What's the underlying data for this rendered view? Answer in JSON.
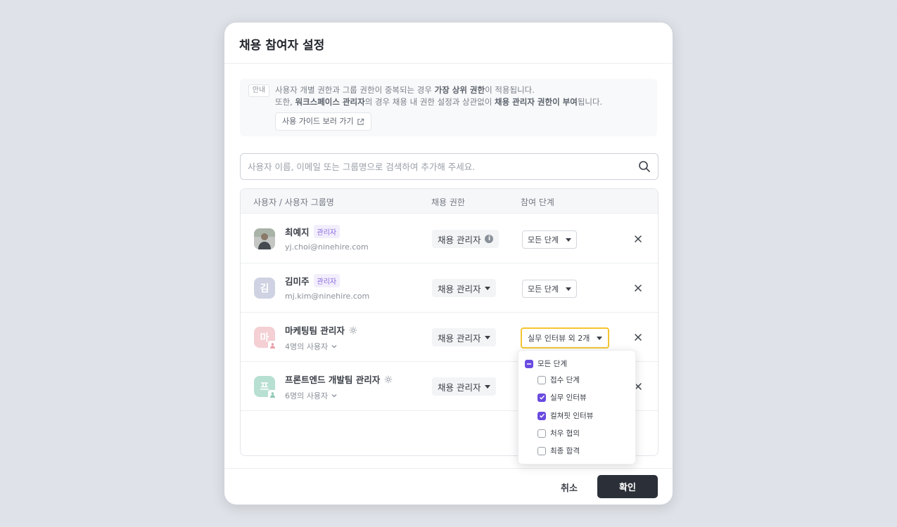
{
  "modal": {
    "title": "채용 참여자 설정"
  },
  "notice": {
    "tag": "안내",
    "line1_pre": "사용자 개별 권한과 그룹 권한이 중복되는 경우 ",
    "line1_bold": "가장 상위 권한",
    "line1_post": "이 적용됩니다.",
    "line2_pre": "또한, ",
    "line2_bold1": "워크스페이스 관리자",
    "line2_mid": "의 경우 채용 내 권한 설정과 상관없이 ",
    "line2_bold2": "채용 관리자 권한이 부여",
    "line2_post": "됩니다.",
    "guide_button": "사용 가이드 보러 가기"
  },
  "search": {
    "placeholder": "사용자 이름, 이메일 또는 그룹명으로 검색하여 추가해 주세요."
  },
  "table": {
    "headers": [
      "사용자 / 사용자 그룹명",
      "채용 권한",
      "참여 단계"
    ],
    "rows": [
      {
        "name": "최예지",
        "badge": "관리자",
        "sub": "yj.choi@ninehire.com",
        "permission": "채용 관리자",
        "stage": "모든 단계"
      },
      {
        "name": "김미주",
        "badge": "관리자",
        "sub": "mj.kim@ninehire.com",
        "avatar_char": "김",
        "permission": "채용 관리자",
        "stage": "모든 단계"
      },
      {
        "name": "마케팅팀 관리자",
        "sub": "4명의 사용자",
        "avatar_char": "마",
        "permission": "채용 관리자",
        "stage": "실무 인터뷰 외 2개"
      },
      {
        "name": "프론트엔드 개발팀 관리자",
        "sub": "6명의 사용자",
        "avatar_char": "프",
        "permission": "채용 관리자"
      }
    ]
  },
  "dropdown": {
    "all_label": "모든 단계",
    "options": [
      {
        "label": "접수 단계",
        "checked": false
      },
      {
        "label": "실무 인터뷰",
        "checked": true
      },
      {
        "label": "컬쳐핏 인터뷰",
        "checked": true
      },
      {
        "label": "처우 협의",
        "checked": false
      },
      {
        "label": "최종 합격",
        "checked": false
      }
    ]
  },
  "footer": {
    "cancel": "취소",
    "confirm": "확인"
  },
  "colors": {
    "accent": "#6a4be0",
    "focus": "#f4c531",
    "primary_button": "#2b3038"
  }
}
